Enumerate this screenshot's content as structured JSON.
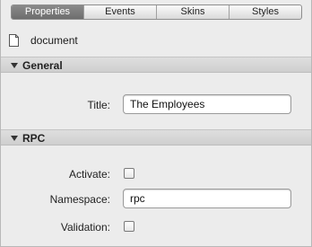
{
  "tabs": [
    {
      "label": "Properties",
      "active": true
    },
    {
      "label": "Events",
      "active": false
    },
    {
      "label": "Skins",
      "active": false
    },
    {
      "label": "Styles",
      "active": false
    }
  ],
  "document": {
    "icon": "document-icon",
    "label": "document"
  },
  "sections": {
    "general": {
      "title": "General",
      "fields": {
        "title": {
          "label": "Title:",
          "value": "The Employees"
        }
      }
    },
    "rpc": {
      "title": "RPC",
      "fields": {
        "activate": {
          "label": "Activate:",
          "checked": false
        },
        "namespace": {
          "label": "Namespace:",
          "value": "rpc"
        },
        "validation": {
          "label": "Validation:",
          "checked": false
        }
      }
    }
  }
}
